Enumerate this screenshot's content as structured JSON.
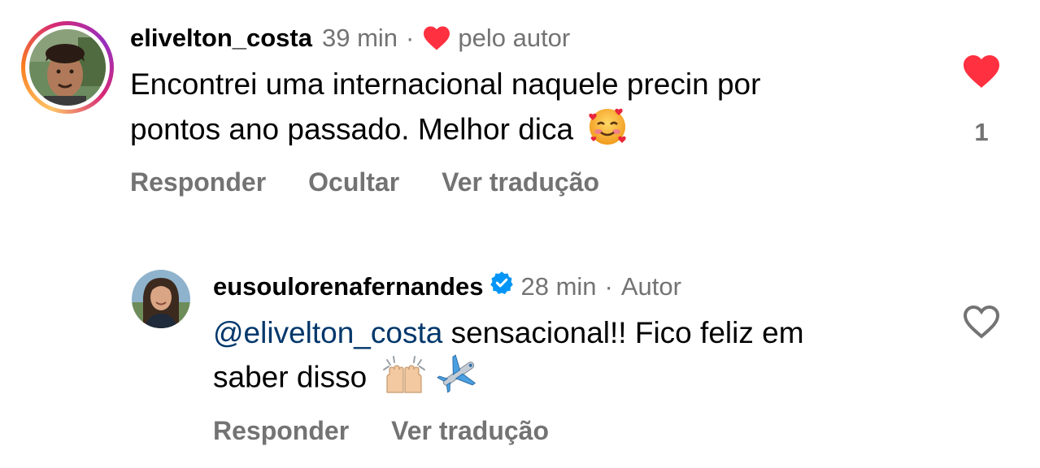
{
  "comments": [
    {
      "username": "elivelton_costa",
      "time": "39 min",
      "separator": "·",
      "tag": "pelo autor",
      "text_line1": "Encontrei uma internacional naquele precin por",
      "text_line2": "pontos ano passado. Melhor dica",
      "actions": [
        "Responder",
        "Ocultar",
        "Ver tradução"
      ],
      "like_count": "1",
      "liked": true,
      "icons": [
        "heart-icon",
        "smiling-face-with-hearts-emoji",
        "heart-filled-icon"
      ]
    },
    {
      "username": "eusoulorenafernandes",
      "verified": true,
      "time": "28 min",
      "separator": "·",
      "tag": "Autor",
      "mention": "@elivelton_costa",
      "text_line1_rest": "sensacional!! Fico feliz em",
      "text_line2": "saber disso",
      "actions": [
        "Responder",
        "Ver tradução"
      ],
      "liked": false,
      "icons": [
        "verified-badge-icon",
        "raising-hands-emoji",
        "airplane-emoji",
        "heart-outline-icon"
      ]
    }
  ],
  "colors": {
    "text": "#000000",
    "meta": "#737373",
    "like_red": "#ff3040",
    "mention_blue": "#00376b",
    "verified_blue": "#0095f6"
  }
}
